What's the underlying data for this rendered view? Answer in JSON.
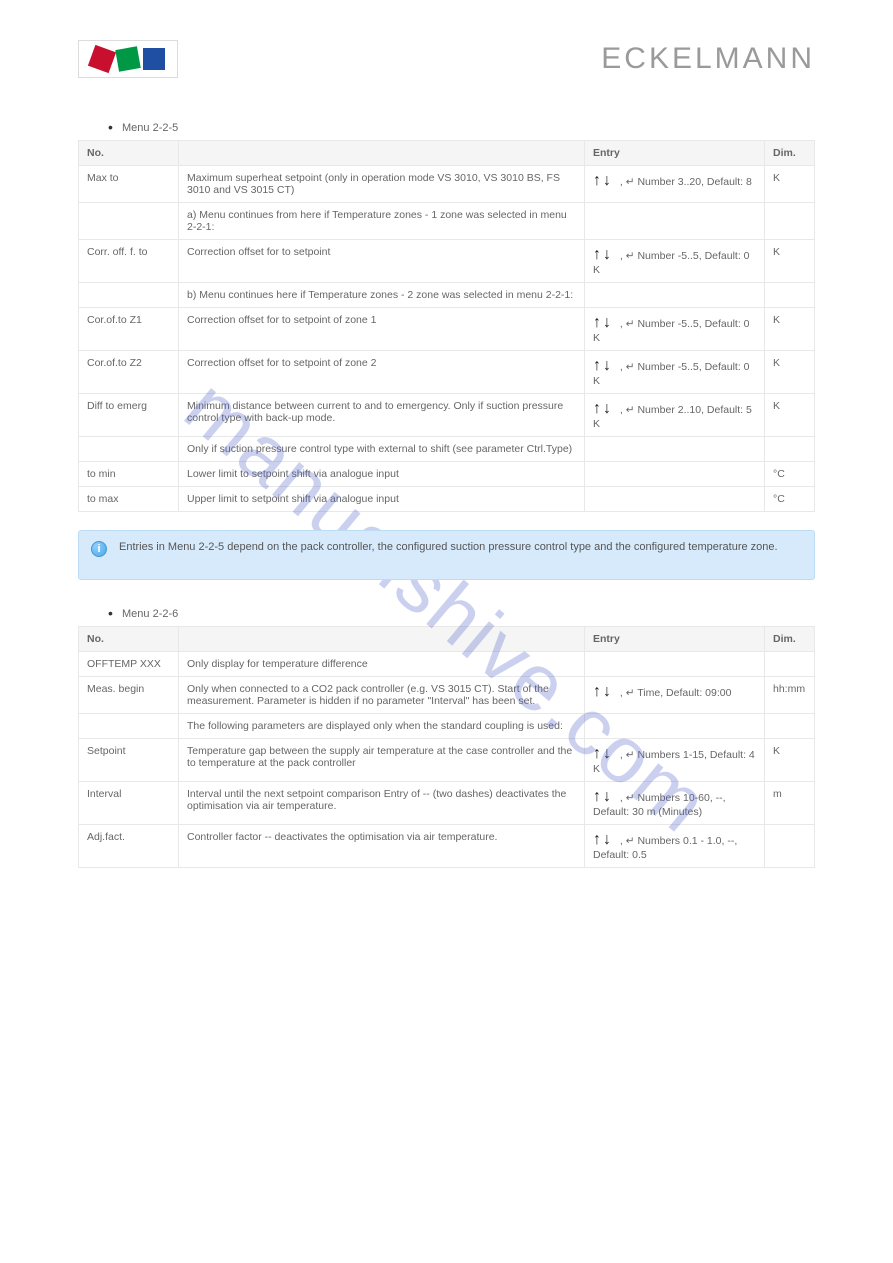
{
  "wordmark": "ECKELMANN",
  "watermark": "manualshive.com",
  "section_a": {
    "bullet": "Menu 2-2-5",
    "headers": [
      "No.",
      "",
      "Entry",
      "Dim."
    ],
    "rows": [
      [
        "Max to",
        "Maximum superheat setpoint (only in operation mode VS 3010, VS 3010 BS, FS 3010 and VS 3015 CT)",
        " , ↵  Number 3..20, Default: 8",
        "K"
      ],
      [
        "",
        "a) Menu continues from here if Temperature zones - 1 zone was selected in menu 2-2-1:",
        "",
        ""
      ],
      [
        "Corr. off. f. to",
        "Correction offset for to setpoint",
        " , ↵  Number -5..5, Default: 0 K",
        "K"
      ],
      [
        "",
        "b) Menu continues here if Temperature zones - 2 zone was selected in menu 2-2-1:",
        "",
        ""
      ],
      [
        "Cor.of.to Z1",
        "Correction offset for to setpoint of zone 1",
        " , ↵  Number -5..5, Default: 0 K",
        "K"
      ],
      [
        "Cor.of.to Z2",
        "Correction offset for to setpoint of zone 2",
        " , ↵  Number -5..5, Default: 0 K",
        "K"
      ],
      [
        "Diff to emerg",
        "Minimum distance between current to and to emergency. Only if suction pressure control type with back-up mode.",
        " , ↵  Number 2..10, Default: 5 K",
        "K"
      ],
      [
        "",
        "Only if suction pressure control type with external to shift (see parameter Ctrl.Type)",
        "",
        ""
      ],
      [
        "to min",
        "Lower limit to setpoint shift via analogue input",
        "",
        "°C"
      ],
      [
        "to max",
        "Upper limit to setpoint shift via analogue input",
        "",
        "°C"
      ]
    ]
  },
  "infobox": "Entries in Menu 2-2-5 depend on the pack controller, the configured suction pressure control type and the configured temperature zone.",
  "section_b": {
    "bullet": "Menu 2-2-6",
    "headers": [
      "No.",
      "",
      "Entry",
      "Dim."
    ],
    "rows": [
      [
        "OFFTEMP XXX",
        "Only display for temperature difference",
        "",
        ""
      ],
      [
        "Meas. begin",
        "Only when connected to a CO2 pack controller (e.g. VS 3015 CT). Start of the measurement. Parameter is hidden if no parameter \"Interval\" has been set.",
        " , ↵  Time, Default: 09:00",
        "hh:mm"
      ],
      [
        "",
        "The following parameters are displayed only when the standard coupling is used:",
        "",
        ""
      ],
      [
        "Setpoint",
        "Temperature gap between the supply air temperature at the case controller and the to temperature at the pack controller",
        " , ↵  Numbers 1-15, Default: 4 K",
        "K"
      ],
      [
        "Interval",
        "Interval until the next setpoint comparison Entry of -- (two dashes) deactivates the optimisation via air temperature.",
        " , ↵  Numbers 10-60, --, Default: 30 m (Minutes)",
        "m"
      ],
      [
        "Adj.fact.",
        "Controller factor -- deactivates the optimisation via air temperature.",
        " , ↵  Numbers 0.1 - 1.0, --, Default: 0.5",
        ""
      ]
    ]
  }
}
